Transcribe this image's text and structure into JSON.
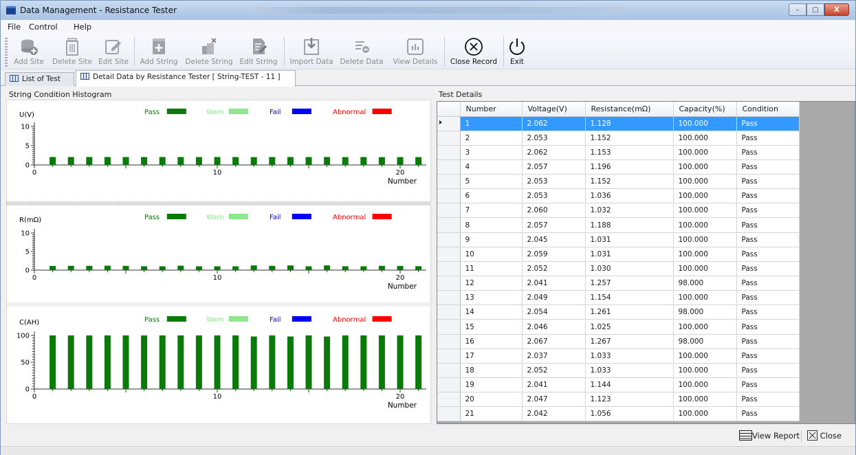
{
  "window": {
    "title": "Data Management - Resistance Tester",
    "blurred_title": "",
    "min_glyph": "–",
    "max_glyph": "▢",
    "close_glyph": "X"
  },
  "menu": [
    "File",
    "Control",
    "Help"
  ],
  "toolbar": {
    "add_site": "Add Site",
    "delete_site": "Delete Site",
    "edit_site": "Edit Site",
    "add_string": "Add String",
    "delete_string": "Delete String",
    "edit_string": "Edit String",
    "import_data": "Import Data",
    "delete_data": "Delete Data",
    "view_details": "View Details",
    "close_record": "Close Record",
    "exit": "Exit"
  },
  "tabs": {
    "list_of_test": "List of Test",
    "detail": "Detail Data by Resistance Tester [ String-TEST - 11 ]"
  },
  "histogram": {
    "title": "String Condition Histogram",
    "legend": [
      {
        "label": "Pass",
        "color": "#0b7a0b"
      },
      {
        "label": "Warn",
        "color": "#8ee68e"
      },
      {
        "label": "Fail",
        "color": "#0000ff"
      },
      {
        "label": "Abnormal",
        "color": "#ff0000"
      }
    ],
    "x_axis_label": "Number"
  },
  "chart_data": [
    {
      "type": "bar",
      "ylabel": "U(V)",
      "xlabel": "Number",
      "ylim": [
        0,
        10
      ],
      "yticks": [
        0,
        5,
        10
      ],
      "xticks": [
        0,
        10,
        20
      ],
      "x": [
        1,
        2,
        3,
        4,
        5,
        6,
        7,
        8,
        9,
        10,
        11,
        12,
        13,
        14,
        15,
        16,
        17,
        18,
        19,
        20,
        21
      ],
      "series": [
        {
          "name": "Pass",
          "values": [
            2.062,
            2.053,
            2.062,
            2.057,
            2.053,
            2.053,
            2.06,
            2.057,
            2.045,
            2.059,
            2.052,
            2.041,
            2.049,
            2.054,
            2.046,
            2.067,
            2.037,
            2.052,
            2.041,
            2.047,
            2.042
          ]
        }
      ]
    },
    {
      "type": "bar",
      "ylabel": "R(mΩ)",
      "xlabel": "Number",
      "ylim": [
        0,
        10
      ],
      "yticks": [
        0,
        5,
        10
      ],
      "xticks": [
        0,
        10,
        20
      ],
      "x": [
        1,
        2,
        3,
        4,
        5,
        6,
        7,
        8,
        9,
        10,
        11,
        12,
        13,
        14,
        15,
        16,
        17,
        18,
        19,
        20,
        21
      ],
      "series": [
        {
          "name": "Pass",
          "values": [
            1.128,
            1.152,
            1.153,
            1.196,
            1.152,
            1.036,
            1.032,
            1.188,
            1.031,
            1.031,
            1.03,
            1.257,
            1.154,
            1.261,
            1.025,
            1.267,
            1.033,
            1.033,
            1.144,
            1.123,
            1.056
          ]
        }
      ]
    },
    {
      "type": "bar",
      "ylabel": "C(AH)",
      "xlabel": "Number",
      "ylim": [
        0,
        100
      ],
      "yticks": [
        0,
        50,
        100
      ],
      "xticks": [
        0,
        10,
        20
      ],
      "x": [
        1,
        2,
        3,
        4,
        5,
        6,
        7,
        8,
        9,
        10,
        11,
        12,
        13,
        14,
        15,
        16,
        17,
        18,
        19,
        20,
        21
      ],
      "series": [
        {
          "name": "Pass",
          "values": [
            100,
            100,
            100,
            100,
            100,
            100,
            100,
            100,
            100,
            100,
            100,
            98,
            100,
            98,
            100,
            98,
            100,
            100,
            100,
            100,
            100
          ]
        }
      ]
    }
  ],
  "details": {
    "title": "Test Details",
    "columns": [
      "Number",
      "Voltage(V)",
      "Resistance(mΩ)",
      "Capacity(%)",
      "Condition"
    ],
    "selected_row": 0,
    "rows": [
      [
        "1",
        "2.062",
        "1.128",
        "100.000",
        "Pass"
      ],
      [
        "2",
        "2.053",
        "1.152",
        "100.000",
        "Pass"
      ],
      [
        "3",
        "2.062",
        "1.153",
        "100.000",
        "Pass"
      ],
      [
        "4",
        "2.057",
        "1.196",
        "100.000",
        "Pass"
      ],
      [
        "5",
        "2.053",
        "1.152",
        "100.000",
        "Pass"
      ],
      [
        "6",
        "2.053",
        "1.036",
        "100.000",
        "Pass"
      ],
      [
        "7",
        "2.060",
        "1.032",
        "100.000",
        "Pass"
      ],
      [
        "8",
        "2.057",
        "1.188",
        "100.000",
        "Pass"
      ],
      [
        "9",
        "2.045",
        "1.031",
        "100.000",
        "Pass"
      ],
      [
        "10",
        "2.059",
        "1.031",
        "100.000",
        "Pass"
      ],
      [
        "11",
        "2.052",
        "1.030",
        "100.000",
        "Pass"
      ],
      [
        "12",
        "2.041",
        "1.257",
        "98.000",
        "Pass"
      ],
      [
        "13",
        "2.049",
        "1.154",
        "100.000",
        "Pass"
      ],
      [
        "14",
        "2.054",
        "1.261",
        "98.000",
        "Pass"
      ],
      [
        "15",
        "2.046",
        "1.025",
        "100.000",
        "Pass"
      ],
      [
        "16",
        "2.067",
        "1.267",
        "98.000",
        "Pass"
      ],
      [
        "17",
        "2.037",
        "1.033",
        "100.000",
        "Pass"
      ],
      [
        "18",
        "2.052",
        "1.033",
        "100.000",
        "Pass"
      ],
      [
        "19",
        "2.041",
        "1.144",
        "100.000",
        "Pass"
      ],
      [
        "20",
        "2.047",
        "1.123",
        "100.000",
        "Pass"
      ],
      [
        "21",
        "2.042",
        "1.056",
        "100.000",
        "Pass"
      ]
    ]
  },
  "bottom": {
    "view_report": "View Report",
    "close": "Close"
  }
}
